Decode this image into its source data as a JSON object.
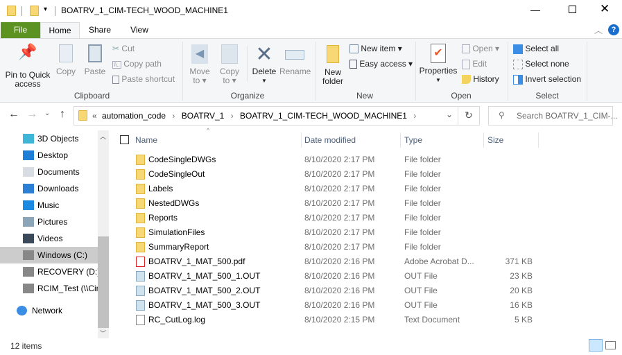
{
  "window": {
    "title": "BOATRV_1_CIM-TECH_WOOD_MACHINE1"
  },
  "ribbon_tabs": [
    "File",
    "Home",
    "Share",
    "View"
  ],
  "ribbon": {
    "clipboard": {
      "label": "Clipboard",
      "pin": "Pin to Quick access",
      "pin_1": "Pin to Quick",
      "pin_2": "access",
      "copy": "Copy",
      "paste": "Paste",
      "cut": "Cut",
      "copy_path": "Copy path",
      "paste_shortcut": "Paste shortcut"
    },
    "organize": {
      "label": "Organize",
      "move_1": "Move",
      "move_2": "to",
      "copy_1": "Copy",
      "copy_2": "to",
      "delete": "Delete",
      "rename": "Rename"
    },
    "new": {
      "label": "New",
      "new_folder_1": "New",
      "new_folder_2": "folder",
      "new_item": "New item",
      "easy_access": "Easy access"
    },
    "open": {
      "label": "Open",
      "properties": "Properties",
      "open": "Open",
      "edit": "Edit",
      "history": "History"
    },
    "select": {
      "label": "Select",
      "select_all": "Select all",
      "select_none": "Select none",
      "invert": "Invert selection"
    }
  },
  "address": {
    "overflow": "«",
    "crumbs": [
      "automation_code",
      "BOATRV_1",
      "BOATRV_1_CIM-TECH_WOOD_MACHINE1"
    ]
  },
  "search": {
    "placeholder": "Search BOATRV_1_CIM-..."
  },
  "nav": {
    "items": [
      {
        "label": "3D Objects",
        "icon": "3d-objects-icon",
        "color": "#3fb6d8"
      },
      {
        "label": "Desktop",
        "icon": "desktop-icon",
        "color": "#1e7fd6"
      },
      {
        "label": "Documents",
        "icon": "documents-icon",
        "color": "#d8dde3"
      },
      {
        "label": "Downloads",
        "icon": "downloads-icon",
        "color": "#2b7fd4"
      },
      {
        "label": "Music",
        "icon": "music-icon",
        "color": "#1b8ae0"
      },
      {
        "label": "Pictures",
        "icon": "pictures-icon",
        "color": "#8aa6b8"
      },
      {
        "label": "Videos",
        "icon": "videos-icon",
        "color": "#3a4a5a"
      },
      {
        "label": "Windows (C:)",
        "icon": "drive-c-icon",
        "color": "#888"
      },
      {
        "label": "RECOVERY (D:)",
        "icon": "drive-d-icon",
        "color": "#888"
      },
      {
        "label": "RCIM_Test (\\\\Cir",
        "icon": "network-drive-disconnected-icon",
        "color": "#888"
      }
    ],
    "network": "Network",
    "selected": "Windows (C:)"
  },
  "columns": {
    "name": "Name",
    "date": "Date modified",
    "type": "Type",
    "size": "Size"
  },
  "files": [
    {
      "name": "CodeSingleDWGs",
      "date": "8/10/2020 2:17 PM",
      "type": "File folder",
      "size": "",
      "kind": "folder"
    },
    {
      "name": "CodeSingleOut",
      "date": "8/10/2020 2:17 PM",
      "type": "File folder",
      "size": "",
      "kind": "folder"
    },
    {
      "name": "Labels",
      "date": "8/10/2020 2:17 PM",
      "type": "File folder",
      "size": "",
      "kind": "folder"
    },
    {
      "name": "NestedDWGs",
      "date": "8/10/2020 2:17 PM",
      "type": "File folder",
      "size": "",
      "kind": "folder"
    },
    {
      "name": "Reports",
      "date": "8/10/2020 2:17 PM",
      "type": "File folder",
      "size": "",
      "kind": "folder"
    },
    {
      "name": "SimulationFiles",
      "date": "8/10/2020 2:17 PM",
      "type": "File folder",
      "size": "",
      "kind": "folder"
    },
    {
      "name": "SummaryReport",
      "date": "8/10/2020 2:17 PM",
      "type": "File folder",
      "size": "",
      "kind": "folder"
    },
    {
      "name": "BOATRV_1_MAT_500.pdf",
      "date": "8/10/2020 2:16 PM",
      "type": "Adobe Acrobat D...",
      "size": "371 KB",
      "kind": "pdf"
    },
    {
      "name": "BOATRV_1_MAT_500_1.OUT",
      "date": "8/10/2020 2:16 PM",
      "type": "OUT File",
      "size": "23 KB",
      "kind": "out"
    },
    {
      "name": "BOATRV_1_MAT_500_2.OUT",
      "date": "8/10/2020 2:16 PM",
      "type": "OUT File",
      "size": "20 KB",
      "kind": "out"
    },
    {
      "name": "BOATRV_1_MAT_500_3.OUT",
      "date": "8/10/2020 2:16 PM",
      "type": "OUT File",
      "size": "16 KB",
      "kind": "out"
    },
    {
      "name": "RC_CutLog.log",
      "date": "8/10/2020 2:15 PM",
      "type": "Text Document",
      "size": "5 KB",
      "kind": "text"
    }
  ],
  "status": {
    "count": "12 items"
  },
  "colors": {
    "file_tab": "#5c9222",
    "accent": "#0078d7",
    "selected_nav": "#cccccc"
  }
}
